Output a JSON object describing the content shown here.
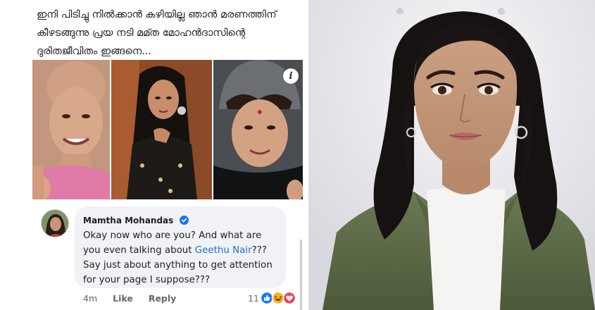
{
  "post": {
    "lines": [
      "ഇനി പിടിച്ചു നിൽക്കാൻ കഴിയില്ല ഞാൻ മരണത്തിന്",
      "കീഴടങ്ങുന്നു പ്രയ നടി മമ്ത മോഹൻദാസിന്റെ",
      "ദുരിതജീവിതം ഇങ്ങനെ..."
    ],
    "info_icon": "i"
  },
  "comment": {
    "author": "Mamtha Mohandas",
    "text_before_mention": "Okay now who are you? And what are you even talking about ",
    "mention": "Geethu Nair",
    "text_after_mention": "??? Say just about anything to get attention for your page I suppose???",
    "time": "4m",
    "like_label": "Like",
    "reply_label": "Reply",
    "reaction_count": "11",
    "reactions": [
      "like-reaction",
      "haha-reaction",
      "love-reaction"
    ]
  },
  "colors": {
    "link_blue": "#216fdb",
    "like_blue": "#1877f2",
    "love_red": "#f33e58",
    "haha_yellow": "#f7b125",
    "blazer_green": "#5f6e49"
  }
}
